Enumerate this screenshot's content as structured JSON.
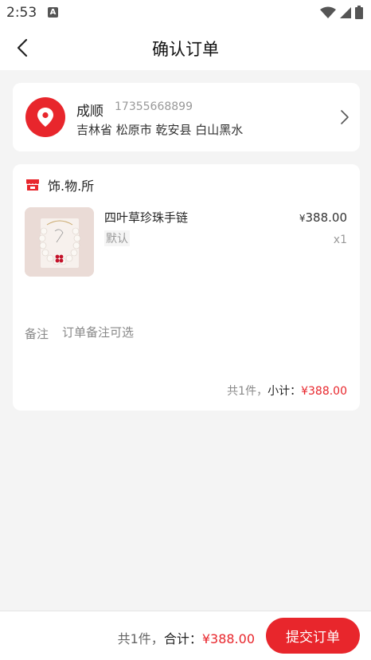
{
  "status_bar": {
    "time": "2:53",
    "notification_letter": "A"
  },
  "nav": {
    "title": "确认订单"
  },
  "address": {
    "name": "成顺",
    "phone": "17355668899",
    "detail": "吉林省 松原市 乾安县 白山黑水"
  },
  "shop": {
    "name": "饰.物.所"
  },
  "product": {
    "name": "四叶草珍珠手链",
    "spec": "默认",
    "currency": "¥",
    "price": "388.00",
    "quantity": "x1"
  },
  "remark": {
    "label": "备注",
    "placeholder": "订单备注可选"
  },
  "subtotal": {
    "count_text": "共1件，",
    "label": "小计：",
    "amount": "¥388.00"
  },
  "footer": {
    "count_text": "共1件，",
    "total_label": "合计：",
    "amount": "¥388.00",
    "submit_label": "提交订单"
  },
  "colors": {
    "accent": "#e8262c",
    "background": "#f4f4f4"
  }
}
